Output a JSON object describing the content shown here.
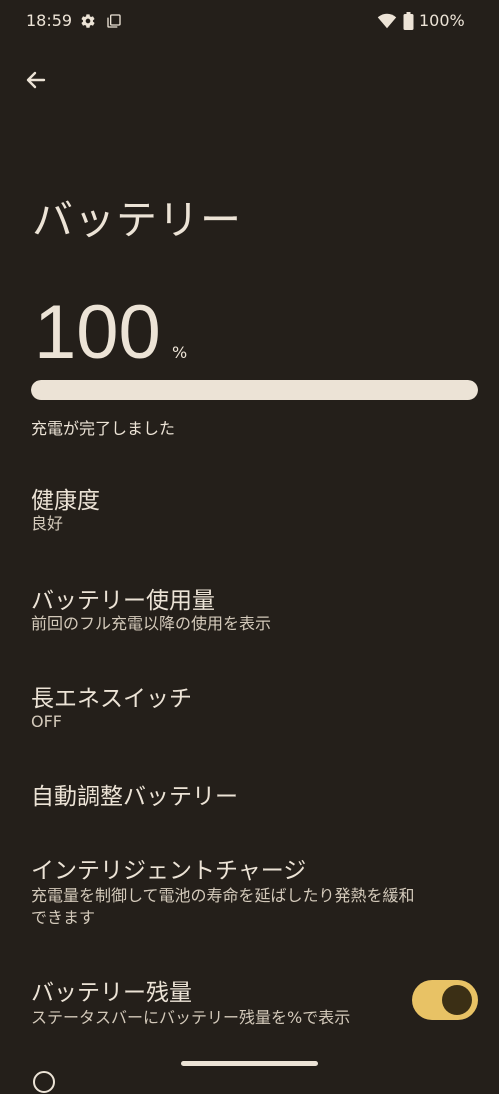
{
  "status_bar": {
    "time": "18:59",
    "battery": "100%",
    "icons": [
      "gear-icon",
      "screen-icon",
      "wifi-icon",
      "battery-icon"
    ]
  },
  "header": {
    "title": "バッテリー"
  },
  "battery_level": {
    "value": "100",
    "unit": "%",
    "percent": 100,
    "status": "充電が完了しました"
  },
  "items": [
    {
      "title": "健康度",
      "summary": "良好"
    },
    {
      "title": "バッテリー使用量",
      "summary": "前回のフル充電以降の使用を表示"
    },
    {
      "title": "長エネスイッチ",
      "summary": "OFF"
    },
    {
      "title": "自動調整バッテリー"
    },
    {
      "title": "インテリジェントチャージ",
      "summary": "充電量を制御して電池の寿命を延ばしたり発熱を緩和できます"
    },
    {
      "title": "バッテリー残量",
      "summary": "ステータスバーにバッテリー残量を%で表示",
      "toggle": true
    }
  ],
  "colors": {
    "background": "#241f1a",
    "text": "#ece3d6",
    "accent": "#e8c265",
    "toggle_thumb": "#3b2f15"
  }
}
